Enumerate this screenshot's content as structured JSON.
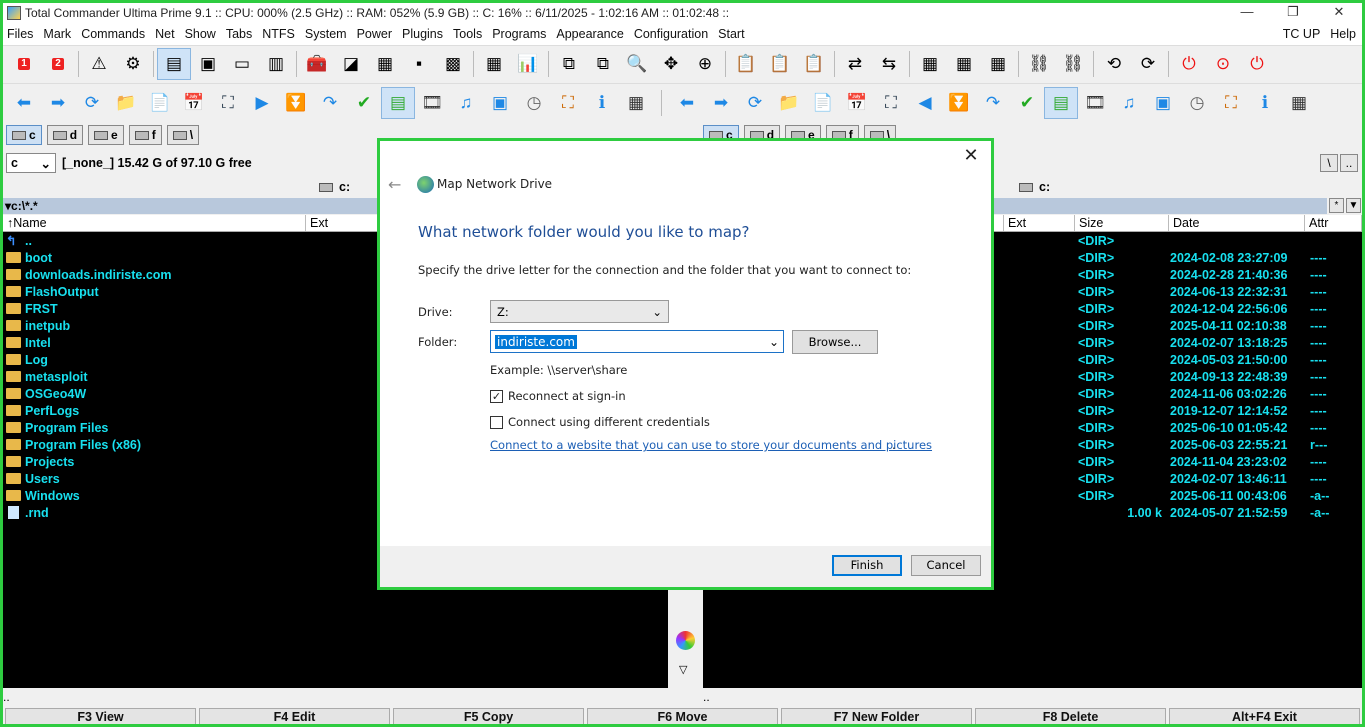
{
  "window": {
    "title": "Total Commander Ultima Prime 9.1 :: CPU: 000% (2.5 GHz) :: RAM: 052% (5.9 GB) :: C: 16% :: 6/11/2025 - 1:02:16 AM :: 01:02:48 ::",
    "minimize": "—",
    "maximize": "❐",
    "close": "✕"
  },
  "menu": {
    "items": [
      "Files",
      "Mark",
      "Commands",
      "Net",
      "Show",
      "Tabs",
      "NTFS",
      "System",
      "Power",
      "Plugins",
      "Tools",
      "Programs",
      "Appearance",
      "Configuration",
      "Start"
    ],
    "right": [
      "TC UP",
      "Help"
    ]
  },
  "toolbar1": [
    "1",
    "2",
    "⚠",
    "⚙",
    "▤",
    "▣",
    "▭",
    "▥",
    "🧰",
    "◪",
    "▦",
    "▪",
    "▩",
    "▦",
    "📊",
    "⧉",
    "⧉",
    "🔍",
    "✥",
    "⊕",
    "📋",
    "📋",
    "📋",
    "⇄",
    "⇆",
    "▦",
    "▦",
    "▦",
    "⛓",
    "⛓",
    "⟲",
    "⟳",
    "⏻",
    "⊙",
    "⏻"
  ],
  "toolbar2_left": [
    "⬅",
    "➡",
    "⟳",
    "📁",
    "📄",
    "📅",
    "⛶",
    "▶",
    "⏬",
    "↷",
    "✔",
    "▤",
    "🎞",
    "♫",
    "▣",
    "◷",
    "⛶",
    "ℹ",
    "▦"
  ],
  "toolbar2_right": [
    "⬅",
    "➡",
    "⟳",
    "📁",
    "📄",
    "📅",
    "⛶",
    "◀",
    "⏬",
    "↷",
    "✔",
    "▤",
    "🎞",
    "♫",
    "▣",
    "◷",
    "⛶",
    "ℹ",
    "▦"
  ],
  "drives_left": [
    "c",
    "d",
    "e",
    "f",
    "\\"
  ],
  "drives_right": [
    "c",
    "d",
    "e",
    "f",
    "\\"
  ],
  "left_panel": {
    "drive_combo": "c",
    "drive_info": "[_none_]  15.42 G of 97.10 G free",
    "header_drive": "c:",
    "path": "▾c:\\*.*",
    "col_name": "↑Name",
    "col_ext": "Ext",
    "files": [
      {
        "name": "..",
        "type": "up"
      },
      {
        "name": "boot",
        "type": "dir"
      },
      {
        "name": "downloads.indiriste.com",
        "type": "dir"
      },
      {
        "name": "FlashOutput",
        "type": "dir"
      },
      {
        "name": "FRST",
        "type": "dir"
      },
      {
        "name": "inetpub",
        "type": "dir"
      },
      {
        "name": "Intel",
        "type": "dir"
      },
      {
        "name": "Log",
        "type": "dir"
      },
      {
        "name": "metasploit",
        "type": "dir"
      },
      {
        "name": "OSGeo4W",
        "type": "dir"
      },
      {
        "name": "PerfLogs",
        "type": "dir"
      },
      {
        "name": "Program Files",
        "type": "dir"
      },
      {
        "name": "Program Files (x86)",
        "type": "dir"
      },
      {
        "name": "Projects",
        "type": "dir"
      },
      {
        "name": "Users",
        "type": "dir"
      },
      {
        "name": "Windows",
        "type": "dir"
      },
      {
        "name": ".rnd",
        "type": "file"
      }
    ],
    "bottom": ".."
  },
  "right_panel": {
    "header_drive": "c:",
    "col_ext": "Ext",
    "col_size": "Size",
    "col_date": "Date",
    "col_attr": "Attr",
    "rows": [
      {
        "size": "<DIR>",
        "date": "",
        "attr": ""
      },
      {
        "size": "<DIR>",
        "date": "2024-02-08 23:27:09",
        "attr": "----"
      },
      {
        "size": "<DIR>",
        "date": "2024-02-28 21:40:36",
        "attr": "----"
      },
      {
        "size": "<DIR>",
        "date": "2024-06-13 22:32:31",
        "attr": "----"
      },
      {
        "size": "<DIR>",
        "date": "2024-12-04 22:56:06",
        "attr": "----"
      },
      {
        "size": "<DIR>",
        "date": "2025-04-11 02:10:38",
        "attr": "----"
      },
      {
        "size": "<DIR>",
        "date": "2024-02-07 13:18:25",
        "attr": "----"
      },
      {
        "size": "<DIR>",
        "date": "2024-05-03 21:50:00",
        "attr": "----"
      },
      {
        "size": "<DIR>",
        "date": "2024-09-13 22:48:39",
        "attr": "----"
      },
      {
        "size": "<DIR>",
        "date": "2024-11-06 03:02:26",
        "attr": "----"
      },
      {
        "size": "<DIR>",
        "date": "2019-12-07 12:14:52",
        "attr": "----"
      },
      {
        "size": "<DIR>",
        "date": "2025-06-10 01:05:42",
        "attr": "----"
      },
      {
        "size": "<DIR>",
        "date": "2025-06-03 22:55:21",
        "attr": "r---"
      },
      {
        "size": "<DIR>",
        "date": "2024-11-04 23:23:02",
        "attr": "----"
      },
      {
        "size": "<DIR>",
        "date": "2024-02-07 13:46:11",
        "attr": "----"
      },
      {
        "size": "<DIR>",
        "date": "2025-06-11 00:43:06",
        "attr": "-a--"
      },
      {
        "size": "1.00 k",
        "date": "2024-05-07 21:52:59",
        "attr": "-a--"
      }
    ],
    "bottom": ".."
  },
  "path_buttons": [
    "\\",
    ".."
  ],
  "sort_buttons": [
    "*",
    "▼"
  ],
  "fkeys": [
    "F3 View",
    "F4 Edit",
    "F5 Copy",
    "F6 Move",
    "F7 New Folder",
    "F8 Delete",
    "Alt+F4 Exit"
  ],
  "dialog": {
    "close": "✕",
    "back": "←",
    "title": "Map Network Drive",
    "heading": "What network folder would you like to map?",
    "description": "Specify the drive letter for the connection and the folder that you want to connect to:",
    "drive_label": "Drive:",
    "drive_value": "Z:",
    "folder_label": "Folder:",
    "folder_value": "indiriste.com",
    "browse": "Browse...",
    "example": "Example: \\\\server\\share",
    "reconnect_label": "Reconnect at sign-in",
    "reconnect_checked": "✓",
    "credentials_label": "Connect using different credentials",
    "link": "Connect to a website that you can use to store your documents and pictures",
    "link_suffix": ".",
    "finish": "Finish",
    "cancel": "Cancel"
  }
}
